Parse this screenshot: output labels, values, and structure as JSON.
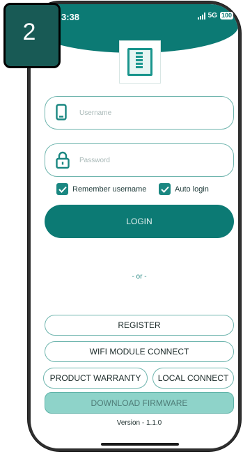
{
  "status_bar": {
    "time": "3:38",
    "network": "5G",
    "battery": "100"
  },
  "step_badge": "2",
  "login": {
    "username_placeholder": "Username",
    "password_placeholder": "Password",
    "remember_label": "Remember username",
    "remember_checked": true,
    "auto_login_label": "Auto login",
    "auto_login_checked": true,
    "login_label": "LOGIN",
    "or_text": "- or -"
  },
  "actions": {
    "register_label": "REGISTER",
    "wifi_label": "WIFI MODULE CONNECT",
    "warranty_label": "PRODUCT WARRANTY",
    "local_label": "LOCAL CONNECT",
    "firmware_label": "DOWNLOAD FIRMWARE"
  },
  "version_text": "Version - 1.1.0",
  "icons": [
    "phone-icon",
    "lock-icon",
    "check-icon",
    "app-logo-icon"
  ],
  "colors": {
    "primary": "#0c7a74",
    "outline": "#6fb5ae",
    "firmware_bg": "#8ed3c9"
  }
}
